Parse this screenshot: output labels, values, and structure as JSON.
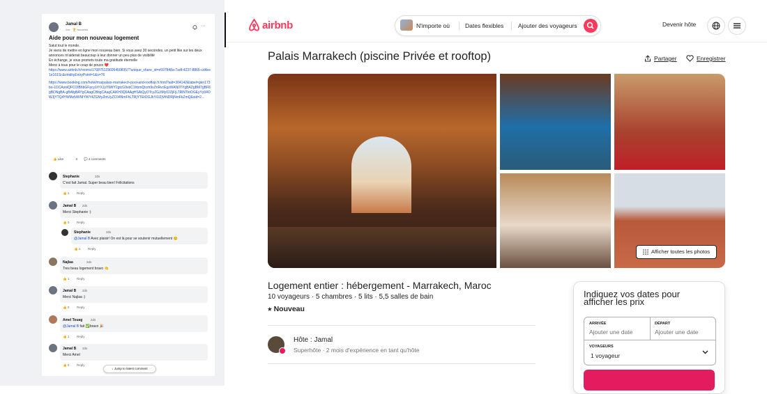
{
  "post": {
    "author": "Jamal B",
    "author_sub": "2ds · 🏆 Nouveau",
    "title": "Aide pour mon nouveau logement",
    "body_lines": [
      "Salut tout le monde,",
      "Je viens de mettre en ligne mon nouveau bien. Si vous avez 30 secondes, un petit like sur les deux",
      "annonces m'aiderait beaucoup à leur donner un peu plus de visibilité",
      "En échange, je vous promets toute ma gratitude éternelle",
      "Merci à tous pour le coup de pouce ❤️"
    ],
    "link1": "https://www.airbnb.fr/rooms/1708751236054508357?unique_share_id=e597848a-7adf-4237-8865-cd4ee1e161Sc&viralityEntryPoint=1&s=76",
    "link2": "https://www.booking.com/hotel/ma/palais-marrakech-pool-and-rooftop.fr.html?aid=304142&label=gen173bo-1DCAsoiQFCOlBhbGFpcy1tYXJyYWtlY2gtcG9vbC1hbmQtcm9vZnRvcEgzWAN0TYgBAZgBM7gBF8gBDNgBA-gBAfgBAYgCAagCBbgCAagCAiKH3Q6AAgHSAiQyOTcyZGJiMy02ZjFjLTRlNTktOGEyYy04OWJjYTQ4YWMzNWNIYWY4ZGMyZmUyZC04NmFhLTRjYTEtOGJkYi1lZjViNDRjNmFkZmQ&sid=2...",
    "likes_label": "Like",
    "likes_count": "3",
    "comments_label": "4 comments",
    "jump_label": "Jump to latest comment"
  },
  "comments": [
    {
      "name": "Stephanie",
      "time": "2ds",
      "text": "C'est fait Jamal. Super beau bien! Félicitations",
      "likes": "1",
      "reply": "Reply"
    },
    {
      "name": "Jamal B",
      "time": "2ds",
      "text": "Merci Stephanie :)",
      "likes": "0",
      "reply": "Reply"
    },
    {
      "name": "Stephanie",
      "time": "2ds",
      "mention": "@Jamal B",
      "text": " Avec plaisir! On est là pour se soutenir mutuellement 😊",
      "likes": "1",
      "reply": "Reply"
    },
    {
      "name": "Najlaa",
      "time": "2ds",
      "text": "Tres beau logement bravo 👏",
      "likes": "1",
      "reply": "Reply"
    },
    {
      "name": "Jamal B",
      "time": "2ds",
      "text": "Merci Najlaa :)",
      "likes": "0",
      "reply": "Reply"
    },
    {
      "name": "Amel Touag",
      "time": "2ds",
      "mention": "@Jamal B",
      "text": " fait ✅bravo 🎉",
      "likes": "1",
      "reply": "Reply"
    },
    {
      "name": "Jamal B",
      "time": "2ds",
      "text": "Merci Amel",
      "likes": "0",
      "reply": "Reply"
    }
  ],
  "airbnb": {
    "logo": "airbnb",
    "search": {
      "anywhere": "N'importe où",
      "dates": "Dates flexibles",
      "guests": "Ajouter des voyageurs"
    },
    "become_host": "Devenir hôte",
    "title": "Palais Marrakech (piscine Privée et rooftop)",
    "share": "Partager",
    "save": "Enregistrer",
    "show_all_photos": "Afficher toutes les photos",
    "subtitle": "Logement entier : hébergement - Marrakech, Maroc",
    "details": "10 voyageurs · 5 chambres · 5 lits · 5,5 salles de bain",
    "new_badge": "⭑ Nouveau",
    "host_name": "Hôte : Jamal",
    "host_sub": "Superhôte · 2 mois d'expérience en tant qu'hôte",
    "booking": {
      "title": "Indiquez vos dates pour afficher les prix",
      "checkin_label": "ARRIVÉE",
      "checkin_value": "Ajouter une date",
      "checkout_label": "DÉPART",
      "checkout_value": "Ajouter une date",
      "guests_label": "VOYAGEURS",
      "guests_value": "1 voyageur"
    },
    "colors": {
      "brand": "#ff385c",
      "button": "#e31c5f"
    }
  }
}
